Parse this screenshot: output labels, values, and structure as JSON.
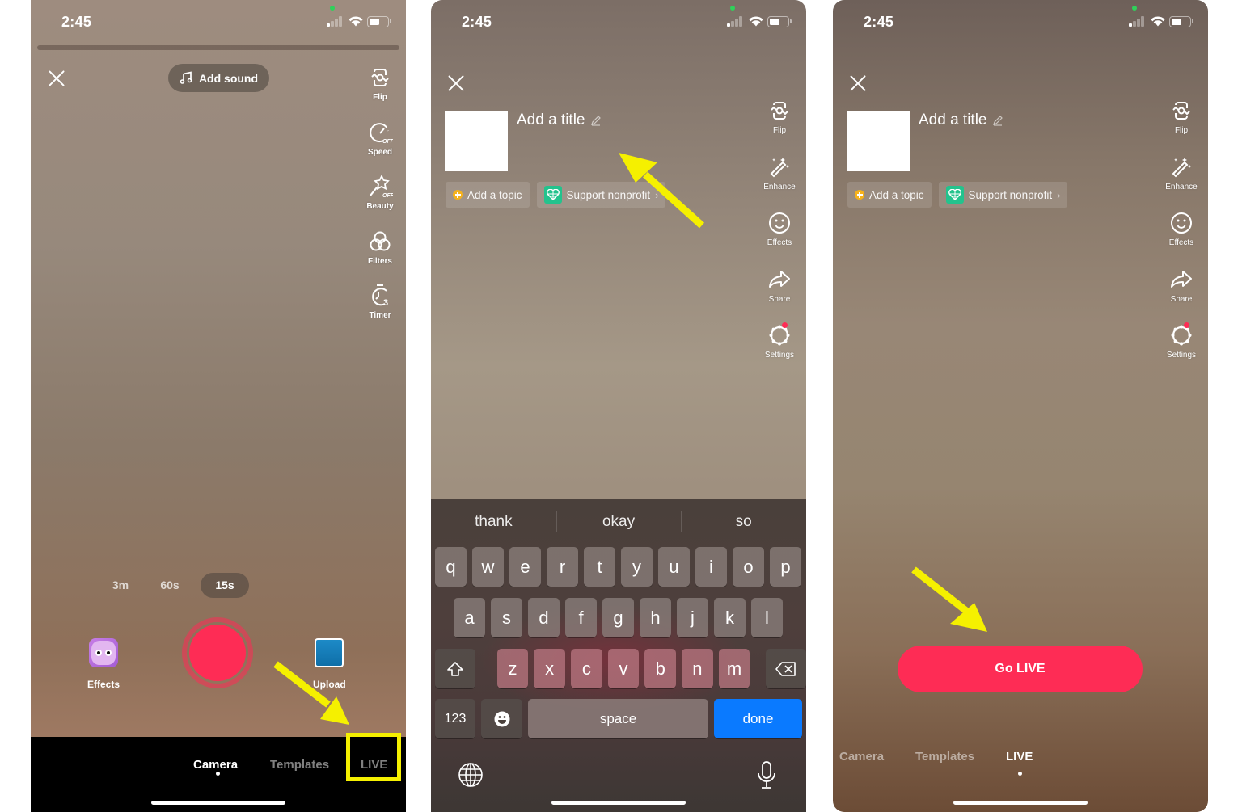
{
  "status_bar": {
    "time": "2:45"
  },
  "panel1": {
    "add_sound_label": "Add sound",
    "tools": [
      {
        "icon": "flip-icon",
        "label": "Flip"
      },
      {
        "icon": "speed-icon",
        "label": "Speed",
        "badge": "OFF"
      },
      {
        "icon": "beauty-icon",
        "label": "Beauty",
        "badge": "OFF"
      },
      {
        "icon": "filters-icon",
        "label": "Filters"
      },
      {
        "icon": "timer-icon",
        "label": "Timer",
        "badge": "3"
      }
    ],
    "durations": [
      {
        "label": "3m",
        "selected": false
      },
      {
        "label": "60s",
        "selected": false
      },
      {
        "label": "15s",
        "selected": true
      }
    ],
    "effects_label": "Effects",
    "upload_label": "Upload",
    "record_color": "#fe2c55",
    "modes": [
      {
        "label": "Camera",
        "selected": true
      },
      {
        "label": "Templates",
        "selected": false
      },
      {
        "label": "LIVE",
        "selected": false,
        "highlighted": true
      }
    ]
  },
  "panel2": {
    "title_placeholder": "Add a title",
    "chips": {
      "topic": "Add a topic",
      "nonprofit": "Support nonprofit"
    },
    "tools": [
      {
        "icon": "flip-icon",
        "label": "Flip"
      },
      {
        "icon": "enhance-icon",
        "label": "Enhance"
      },
      {
        "icon": "effects-icon",
        "label": "Effects"
      },
      {
        "icon": "share-icon",
        "label": "Share"
      },
      {
        "icon": "settings-icon",
        "label": "Settings",
        "notification": true
      }
    ],
    "keyboard": {
      "suggestions": [
        "thank",
        "okay",
        "so"
      ],
      "row1": [
        "q",
        "w",
        "e",
        "r",
        "t",
        "y",
        "u",
        "i",
        "o",
        "p"
      ],
      "row2": [
        "a",
        "s",
        "d",
        "f",
        "g",
        "h",
        "j",
        "k",
        "l"
      ],
      "row3": [
        "z",
        "x",
        "c",
        "v",
        "b",
        "n",
        "m"
      ],
      "numbers_label": "123",
      "space_label": "space",
      "done_label": "done",
      "done_color": "#0a7aff"
    }
  },
  "panel3": {
    "title_placeholder": "Add a title",
    "chips": {
      "topic": "Add a topic",
      "nonprofit": "Support nonprofit"
    },
    "tools": [
      {
        "icon": "flip-icon",
        "label": "Flip"
      },
      {
        "icon": "enhance-icon",
        "label": "Enhance"
      },
      {
        "icon": "effects-icon",
        "label": "Effects"
      },
      {
        "icon": "share-icon",
        "label": "Share"
      },
      {
        "icon": "settings-icon",
        "label": "Settings",
        "notification": true
      }
    ],
    "go_live_label": "Go LIVE",
    "go_live_color": "#fe2c55",
    "modes": [
      {
        "label": "Camera",
        "selected": false
      },
      {
        "label": "Templates",
        "selected": false
      },
      {
        "label": "LIVE",
        "selected": true
      }
    ]
  },
  "annotations": {
    "arrow_color": "#f5f000",
    "box_color": "#f5f000"
  }
}
